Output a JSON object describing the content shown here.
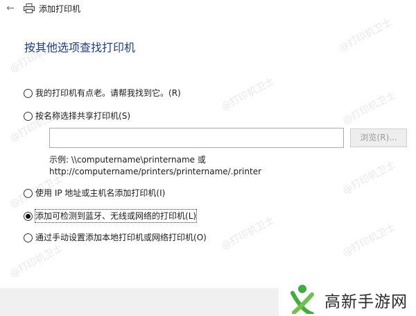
{
  "window": {
    "title": "添加打印机"
  },
  "heading": "按其他选项查找打印机",
  "options": [
    {
      "label": "我的打印机有点老。请帮我找到它。",
      "accel": "(R)",
      "selected": false
    },
    {
      "label": "按名称选择共享打印机",
      "accel": "(S)",
      "selected": false
    },
    {
      "label": "使用 IP 地址或主机名添加打印机",
      "accel": "(I)",
      "selected": false
    },
    {
      "label": "添加可检测到蓝牙、无线或网络的打印机",
      "accel": "(L)",
      "selected": true
    },
    {
      "label": "通过手动设置添加本地打印机或网络打印机",
      "accel": "(O)",
      "selected": false
    }
  ],
  "share": {
    "input_value": "",
    "browse_label": "浏览(R)...",
    "example_line1": "示例: \\\\computername\\printername 或",
    "example_line2": "http://computername/printers/printername/.printer"
  },
  "watermark": {
    "text": "@打印机卫士"
  },
  "brand": {
    "name": "高新手游网"
  },
  "colors": {
    "heading": "#1e3c8c",
    "footer": "#f0f0f0",
    "brand_green": "#3fae3a"
  },
  "icons": {
    "back": "back-arrow-icon",
    "printer": "printer-icon",
    "logo": "brand-logo-icon"
  }
}
